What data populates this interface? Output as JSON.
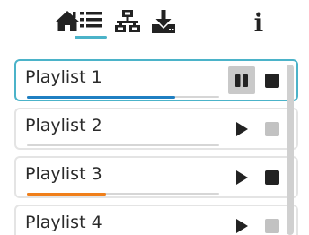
{
  "toolbar": {
    "buttons": [
      {
        "icon": "home-icon",
        "label": "Home"
      },
      {
        "icon": "list-icon",
        "label": "Playlists",
        "active": true
      },
      {
        "icon": "network-icon",
        "label": "Network"
      },
      {
        "icon": "download-icon",
        "label": "Download"
      },
      {
        "icon": "info-icon",
        "label": "i"
      }
    ],
    "accent_color": "#4bb3c9"
  },
  "playlists": [
    {
      "name": "Playlist 1",
      "selected": true,
      "state": "playing",
      "progress": 0.77,
      "progress_color": "#1f7fc2",
      "stop_enabled": true
    },
    {
      "name": "Playlist 2",
      "selected": false,
      "state": "stopped",
      "progress": 0,
      "progress_color": "#1f7fc2",
      "stop_enabled": false
    },
    {
      "name": "Playlist 3",
      "selected": false,
      "state": "paused",
      "progress": 0.41,
      "progress_color": "#f07f1a",
      "stop_enabled": true
    },
    {
      "name": "Playlist 4",
      "selected": false,
      "state": "stopped",
      "progress": 0,
      "progress_color": "#1f7fc2",
      "stop_enabled": false
    }
  ],
  "colors": {
    "icon": "#222222",
    "stop_enabled": "#222222",
    "stop_disabled": "#c2c2c2",
    "active_button_bg": "#c9c9c9"
  }
}
